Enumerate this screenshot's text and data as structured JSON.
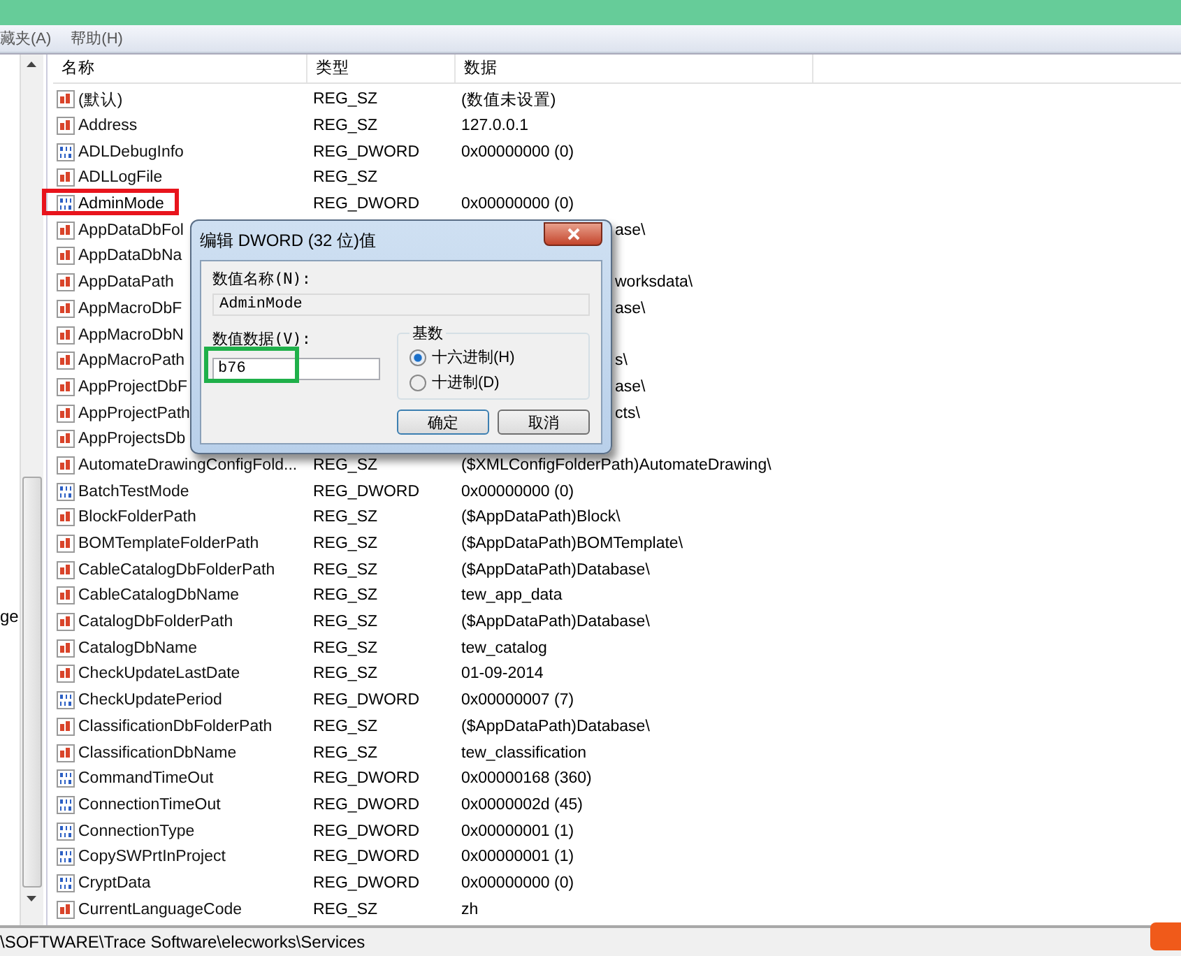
{
  "menu": [
    "藏夹(A)",
    "帮助(H)"
  ],
  "tree": {
    "items": [
      "ge"
    ]
  },
  "table": {
    "columns": [
      "名称",
      "类型",
      "数据"
    ],
    "rows": [
      {
        "kind": "sz",
        "name": "(默认)",
        "type": "REG_SZ",
        "data": "(数值未设置)",
        "selected": false
      },
      {
        "kind": "sz",
        "name": "Address",
        "type": "REG_SZ",
        "data": "127.0.0.1",
        "selected": false
      },
      {
        "kind": "dword",
        "name": "ADLDebugInfo",
        "type": "REG_DWORD",
        "data": "0x00000000 (0)",
        "selected": false
      },
      {
        "kind": "sz",
        "name": "ADLLogFile",
        "type": "REG_SZ",
        "selected": false
      },
      {
        "kind": "dword",
        "name": "AdminMode",
        "type": "REG_DWORD",
        "data": "0x00000000 (0)",
        "selected": true
      },
      {
        "kind": "sz",
        "name": "AppDataDbFol",
        "data": "ase\\",
        "selected": false
      },
      {
        "kind": "sz",
        "name": "AppDataDbNa",
        "selected": false
      },
      {
        "kind": "sz",
        "name": "AppDataPath",
        "data": "worksdata\\",
        "selected": false
      },
      {
        "kind": "sz",
        "name": "AppMacroDbF",
        "data": "ase\\",
        "selected": false
      },
      {
        "kind": "sz",
        "name": "AppMacroDbN",
        "selected": false
      },
      {
        "kind": "sz",
        "name": "AppMacroPath",
        "data": "s\\",
        "selected": false
      },
      {
        "kind": "sz",
        "name": "AppProjectDbF",
        "data": "ase\\",
        "selected": false
      },
      {
        "kind": "sz",
        "name": "AppProjectPath",
        "data": "cts\\",
        "selected": false
      },
      {
        "kind": "sz",
        "name": "AppProjectsDb",
        "selected": false
      },
      {
        "kind": "sz",
        "name": "AutomateDrawingConfigFold...",
        "type": "REG_SZ",
        "data": "($XMLConfigFolderPath)AutomateDrawing\\",
        "selected": false
      },
      {
        "kind": "dword",
        "name": "BatchTestMode",
        "type": "REG_DWORD",
        "data": "0x00000000 (0)",
        "selected": false
      },
      {
        "kind": "sz",
        "name": "BlockFolderPath",
        "type": "REG_SZ",
        "data": "($AppDataPath)Block\\",
        "selected": false
      },
      {
        "kind": "sz",
        "name": "BOMTemplateFolderPath",
        "type": "REG_SZ",
        "data": "($AppDataPath)BOMTemplate\\",
        "selected": false
      },
      {
        "kind": "sz",
        "name": "CableCatalogDbFolderPath",
        "type": "REG_SZ",
        "data": "($AppDataPath)Database\\",
        "selected": false
      },
      {
        "kind": "sz",
        "name": "CableCatalogDbName",
        "type": "REG_SZ",
        "data": "tew_app_data",
        "selected": false
      },
      {
        "kind": "sz",
        "name": "CatalogDbFolderPath",
        "type": "REG_SZ",
        "data": "($AppDataPath)Database\\",
        "selected": false
      },
      {
        "kind": "sz",
        "name": "CatalogDbName",
        "type": "REG_SZ",
        "data": "tew_catalog",
        "selected": false
      },
      {
        "kind": "sz",
        "name": "CheckUpdateLastDate",
        "type": "REG_SZ",
        "data": "01-09-2014",
        "selected": false
      },
      {
        "kind": "dword",
        "name": "CheckUpdatePeriod",
        "type": "REG_DWORD",
        "data": "0x00000007 (7)",
        "selected": false
      },
      {
        "kind": "sz",
        "name": "ClassificationDbFolderPath",
        "type": "REG_SZ",
        "data": "($AppDataPath)Database\\",
        "selected": false
      },
      {
        "kind": "sz",
        "name": "ClassificationDbName",
        "type": "REG_SZ",
        "data": "tew_classification",
        "selected": false
      },
      {
        "kind": "dword",
        "name": "CommandTimeOut",
        "type": "REG_DWORD",
        "data": "0x00000168 (360)",
        "selected": false
      },
      {
        "kind": "dword",
        "name": "ConnectionTimeOut",
        "type": "REG_DWORD",
        "data": "0x0000002d (45)",
        "selected": false
      },
      {
        "kind": "dword",
        "name": "ConnectionType",
        "type": "REG_DWORD",
        "data": "0x00000001 (1)",
        "selected": false
      },
      {
        "kind": "dword",
        "name": "CopySWPrtInProject",
        "type": "REG_DWORD",
        "data": "0x00000001 (1)",
        "selected": false
      },
      {
        "kind": "dword",
        "name": "CryptData",
        "type": "REG_DWORD",
        "data": "0x00000000 (0)",
        "selected": false
      },
      {
        "kind": "sz",
        "name": "CurrentLanguageCode",
        "type": "REG_SZ",
        "data": "zh",
        "selected": false
      }
    ]
  },
  "dialog": {
    "title": "编辑 DWORD (32 位)值",
    "name_label": "数值名称(N):",
    "name_value": "AdminMode",
    "data_label": "数值数据(V):",
    "data_value": "b76",
    "base_label": "基数",
    "bases": [
      {
        "label": "十六进制(H)",
        "selected": true
      },
      {
        "label": "十进制(D)",
        "selected": false
      }
    ],
    "buttons": [
      "确定",
      "取消"
    ]
  },
  "status_bar": "\\SOFTWARE\\Trace Software\\elecworks\\Services"
}
